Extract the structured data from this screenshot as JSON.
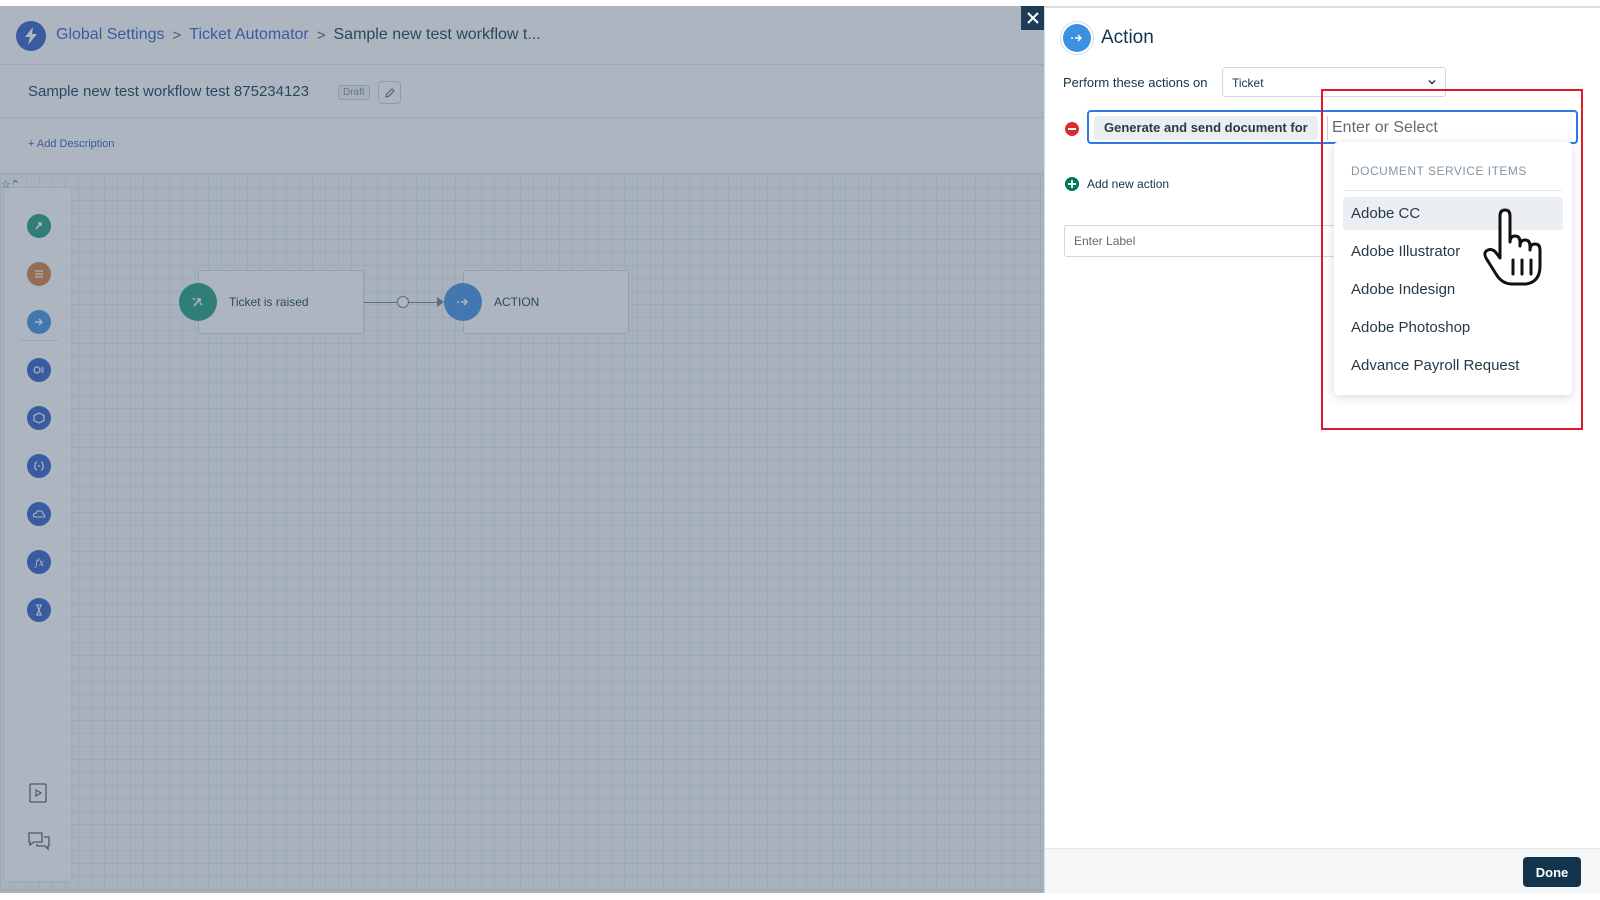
{
  "header": {
    "breadcrumbs": [
      "Global Settings",
      "Ticket Automator",
      "Sample new test workflow t..."
    ],
    "separator": ">"
  },
  "workflow": {
    "title": "Sample new test workflow test 875234123",
    "status_badge": "Draft",
    "add_description": "+ Add Description"
  },
  "canvas": {
    "trigger_node": "Ticket is raised",
    "action_node": "ACTION",
    "palette_icons": [
      "trigger-icon",
      "condition-icon",
      "action-icon",
      "query-icon",
      "app-icon",
      "expression-icon",
      "cloud-icon",
      "function-icon",
      "timer-icon"
    ],
    "bottom_icons": [
      "docs-icon",
      "chat-icon"
    ]
  },
  "panel": {
    "title": "Action",
    "perform_label": "Perform these actions on",
    "perform_value": "Ticket",
    "action_chip": "Generate and send document for",
    "action_placeholder": "Enter or Select",
    "add_new_action": "Add new action",
    "label_placeholder": "Enter Label",
    "done_label": "Done"
  },
  "dropdown": {
    "header": "DOCUMENT SERVICE ITEMS",
    "items": [
      "Adobe CC",
      "Adobe Illustrator",
      "Adobe Indesign",
      "Adobe Photoshop",
      "Advance Payroll Request"
    ],
    "hovered_index": 0
  },
  "colors": {
    "brand": "#2c5cc5",
    "overlay": "#4a5d74",
    "highlight": "#e0192a",
    "done_button": "#12344d"
  }
}
